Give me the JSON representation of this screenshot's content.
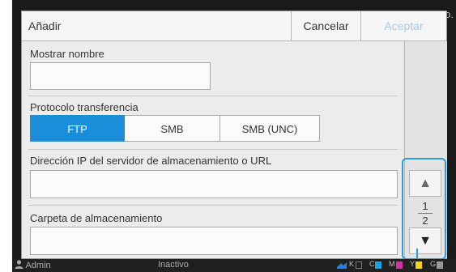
{
  "dialog": {
    "title": "Añadir",
    "cancel_label": "Cancelar",
    "accept_label": "Aceptar"
  },
  "fields": {
    "display_name_label": "Mostrar nombre",
    "display_name_value": "",
    "protocol_label": "Protocolo transferencia",
    "protocol_options": [
      "FTP",
      "SMB",
      "SMB (UNC)"
    ],
    "protocol_selected": "FTP",
    "server_label": "Dirección IP del servidor de almacenamiento o URL",
    "server_value": "",
    "folder_label": "Carpeta de almacenamiento",
    "folder_value": ""
  },
  "pager": {
    "current": "1",
    "total": "2"
  },
  "background": {
    "peek_text": "o."
  },
  "statusbar": {
    "user": "Admin",
    "state": "Inactivo",
    "inks": [
      "K",
      "C",
      "M",
      "Y",
      "G"
    ]
  },
  "colors": {
    "accent": "#1a8ed8",
    "accept_disabled": "#a9c9e6",
    "frame_highlight": "#2a9be0",
    "ink_k": "#1c1c1c",
    "ink_c": "#1aa3df",
    "ink_m": "#d0349d",
    "ink_y": "#f5d21c",
    "ink_g": "#999999"
  },
  "icons": {
    "user": "user-icon",
    "scroll_up": "triangle-up-icon",
    "scroll_down": "triangle-down-icon"
  }
}
